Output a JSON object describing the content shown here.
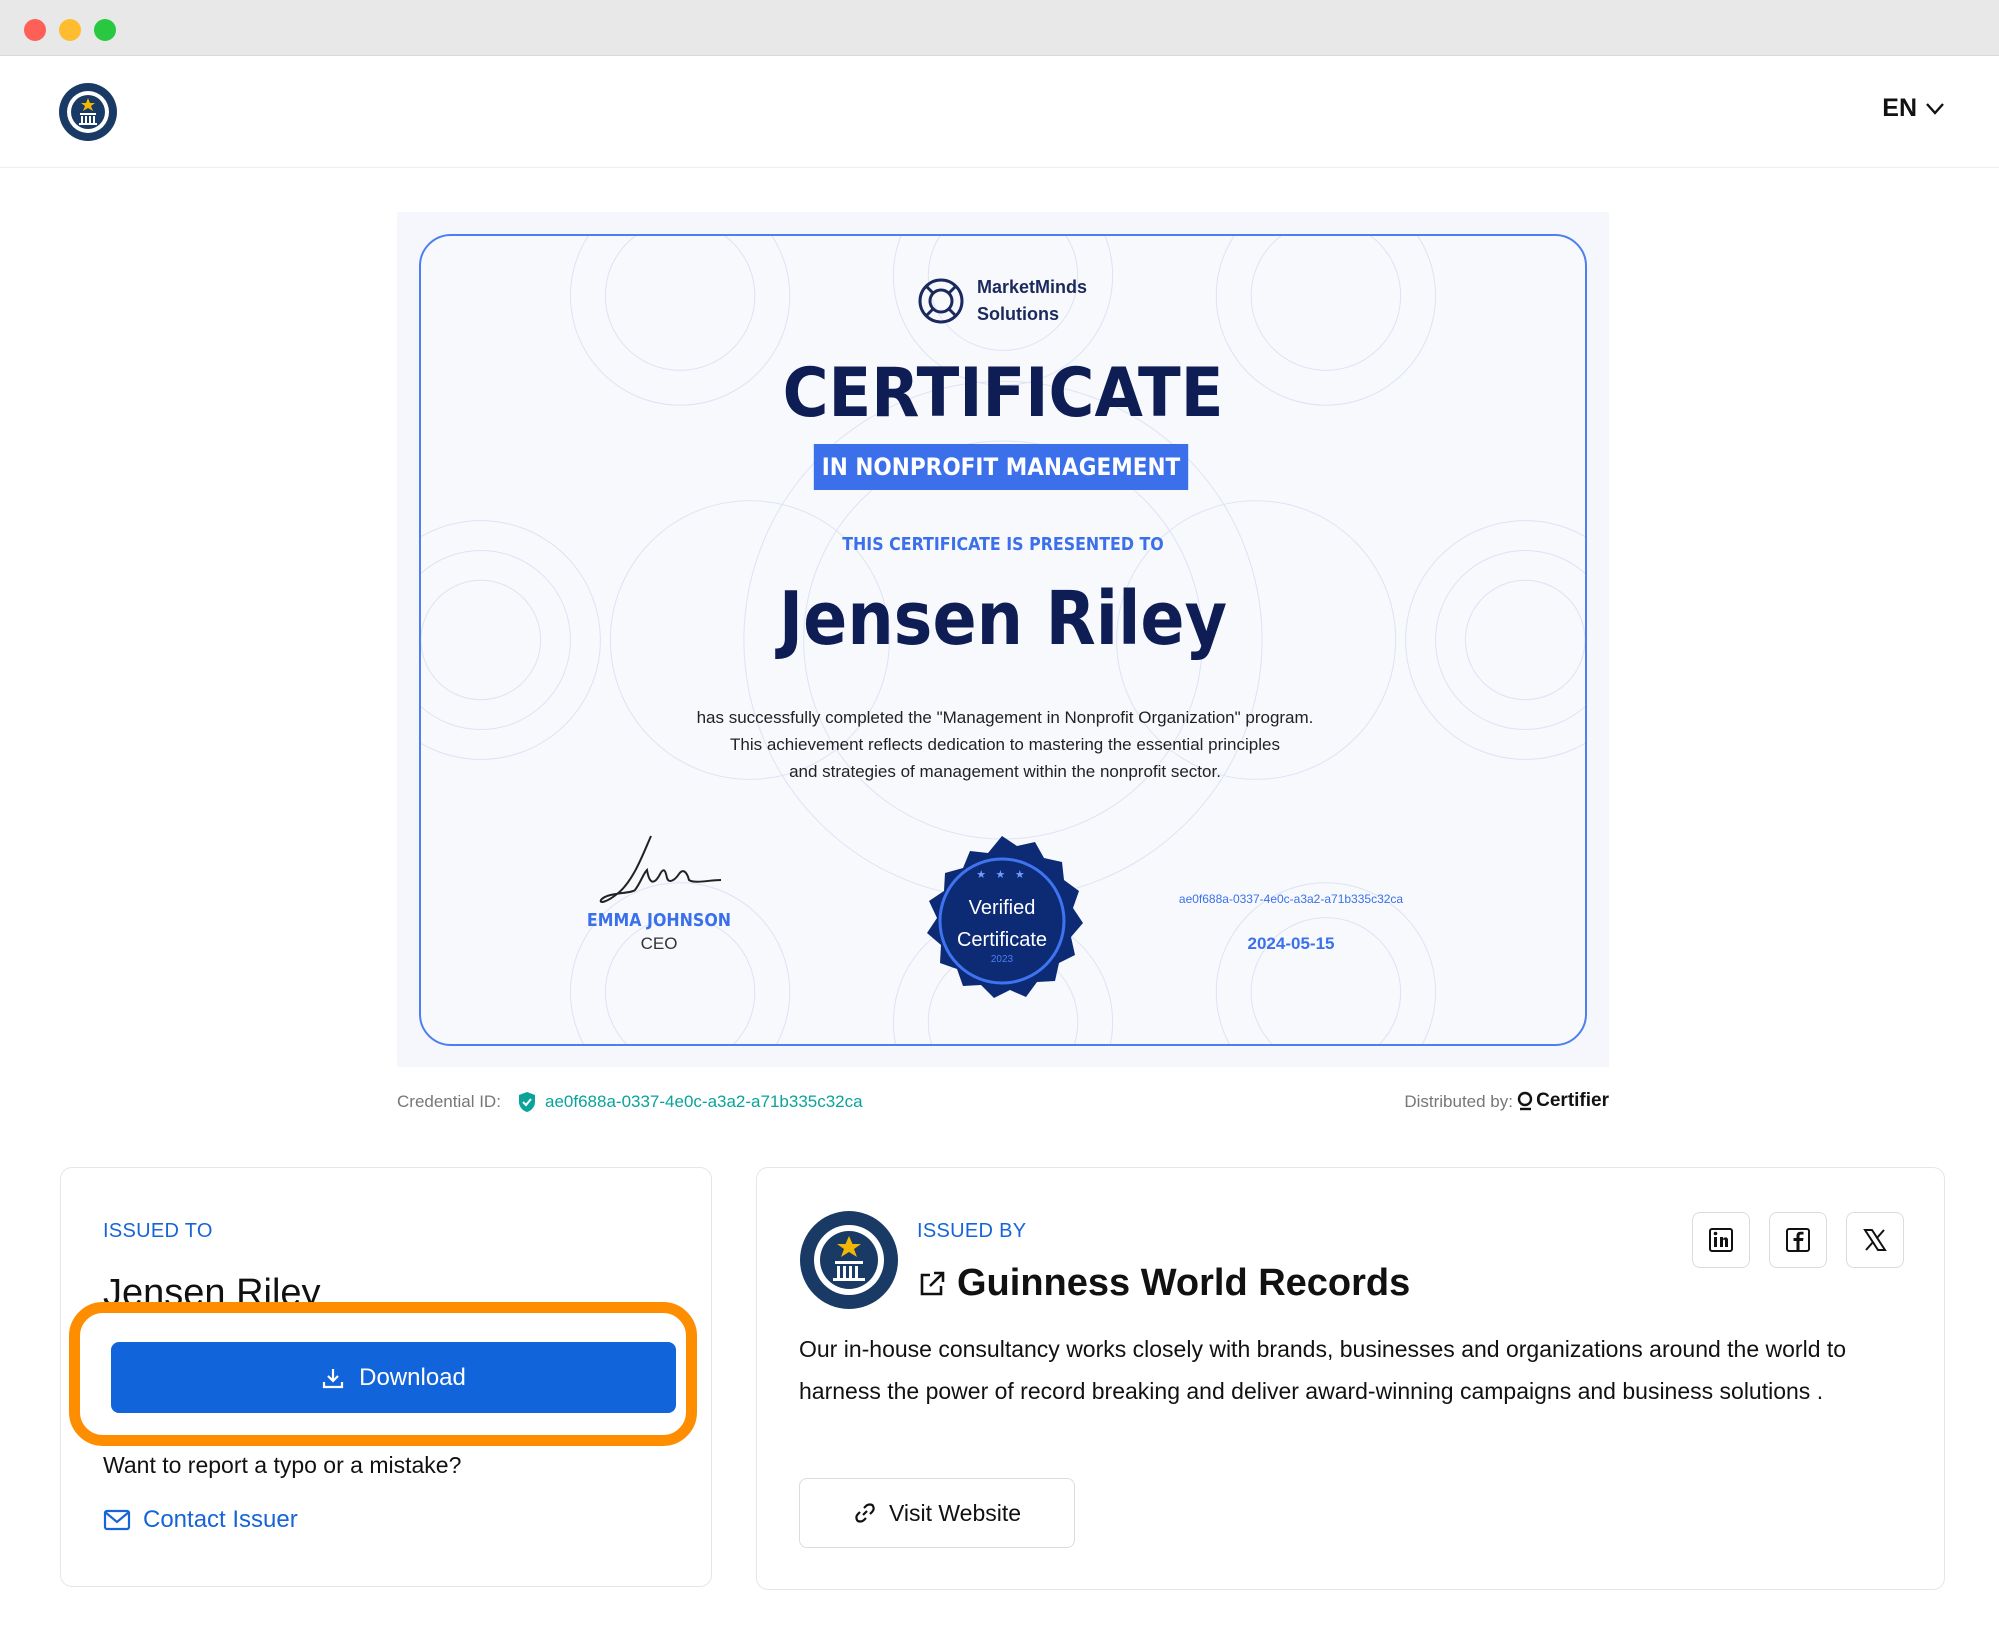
{
  "header": {
    "language": "EN"
  },
  "certificate": {
    "brand": [
      "MarketMinds",
      "Solutions"
    ],
    "title": "CERTIFICATE",
    "subtitle": "IN NONPROFIT MANAGEMENT",
    "presented_to": "THIS CERTIFICATE IS PRESENTED TO",
    "recipient": "Jensen Riley",
    "description": [
      "has successfully completed the \"Management in Nonprofit Organization\" program.",
      "This achievement reflects dedication to mastering the essential principles",
      "and strategies of management within the nonprofit sector."
    ],
    "signer_name": "EMMA JOHNSON",
    "signer_role": "CEO",
    "seal_line1": "Verified",
    "seal_line2": "Certificate",
    "seal_year": "2023",
    "seal_stars": "★ ★ ★",
    "id": "ae0f688a-0337-4e0c-a3a2-a71b335c32ca",
    "date": "2024-05-15"
  },
  "credential": {
    "label": "Credential ID:",
    "value": "ae0f688a-0337-4e0c-a3a2-a71b335c32ca",
    "distributed_label": "Distributed by:",
    "distributor": "Certifier"
  },
  "issued_to": {
    "label": "ISSUED TO",
    "name": "Jensen Riley",
    "download_label": "Download",
    "typo_text": "Want to report a typo or a mistake?",
    "contact_label": "Contact Issuer"
  },
  "issuer": {
    "label": "ISSUED BY",
    "name": "Guinness World Records",
    "description": "Our in-house consultancy works closely with brands, businesses and organizations around the world to harness the power of record breaking and deliver award-winning campaigns and business solutions .",
    "visit_label": "Visit Website"
  },
  "colors": {
    "accent": "#1264da",
    "highlight": "#ff8d00",
    "cert_blue": "#3b70ea",
    "cert_navy": "#0e1d54",
    "teal": "#0aa39a"
  },
  "icons": [
    "gwr-logo",
    "chevron-down-icon",
    "marketminds-logo",
    "signature",
    "verified-seal",
    "shield-check-icon",
    "certifier-logo",
    "download-icon",
    "mail-icon",
    "external-link-icon",
    "link-icon",
    "linkedin-icon",
    "facebook-icon",
    "x-icon"
  ]
}
